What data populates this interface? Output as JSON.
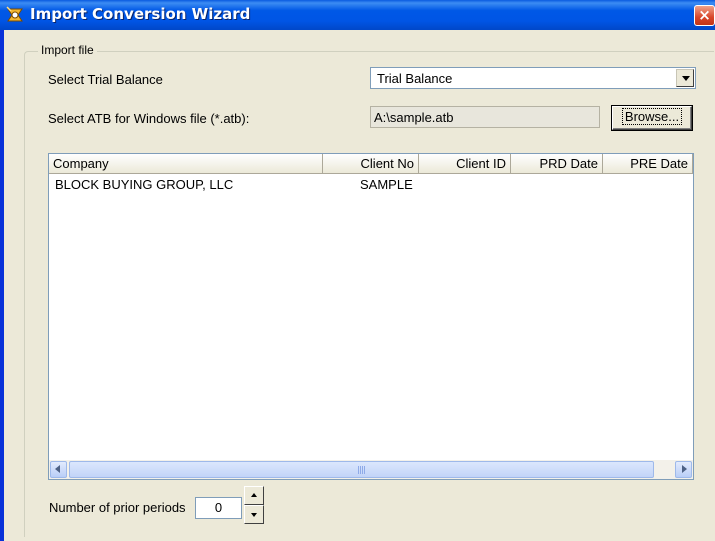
{
  "window": {
    "title": "Import Conversion Wizard",
    "close_label": "×"
  },
  "import_group": {
    "legend": "Import file",
    "trial_balance_label": "Select Trial Balance",
    "trial_balance_value": "Trial Balance",
    "atb_label": "Select ATB for Windows file (*.atb):",
    "atb_path": "A:\\sample.atb",
    "browse_label": "Browse..."
  },
  "table": {
    "columns": [
      "Company",
      "Client No",
      "Client ID",
      "PRD Date",
      "PRE Date"
    ],
    "rows": [
      {
        "company": "BLOCK BUYING GROUP, LLC",
        "client_no": "SAMPLE",
        "client_id": "",
        "prd_date": "",
        "pre_date": ""
      }
    ],
    "scroll_grip": "III"
  },
  "prior_periods": {
    "label": "Number of prior periods",
    "value": "0"
  },
  "colors": {
    "titlebar": "#0058e6",
    "dialog_bg": "#ece9d8",
    "close_button": "#d8452a"
  },
  "icons": {
    "title": "wizard-app-icon",
    "dropdown": "chevron-down-icon",
    "scroll_left": "arrow-left-icon",
    "scroll_right": "arrow-right-icon",
    "spin_up": "arrow-up-icon",
    "spin_down": "arrow-down-icon"
  }
}
